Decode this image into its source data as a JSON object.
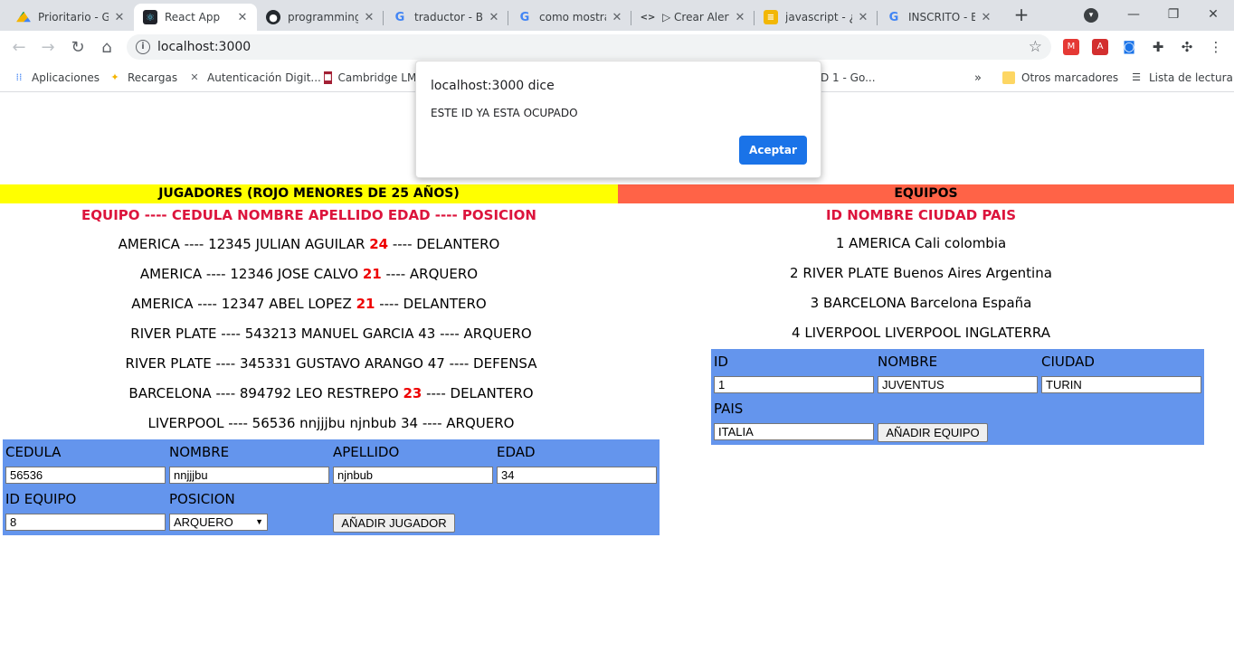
{
  "browser": {
    "tabs": [
      {
        "title": "Prioritario - G",
        "icon": "google-drive-icon"
      },
      {
        "title": "React App",
        "icon": "react-icon"
      },
      {
        "title": "programming",
        "icon": "github-icon"
      },
      {
        "title": "traductor - Bu",
        "icon": "google-icon"
      },
      {
        "title": "como mostrar",
        "icon": "google-icon"
      },
      {
        "title": "▷ Crear Alert",
        "icon": "code-icon"
      },
      {
        "title": "javascript - ¿C",
        "icon": "stackoverflow-icon"
      },
      {
        "title": "INSCRITO - Bu",
        "icon": "google-icon"
      }
    ],
    "url": "localhost:3000",
    "bookmarks": [
      {
        "label": "Aplicaciones",
        "icon": "apps-grid-icon"
      },
      {
        "label": "Recargas",
        "icon": "recargas-icon"
      },
      {
        "label": "Autenticación Digit...",
        "icon": "tools-icon"
      },
      {
        "label": "Cambridge LM",
        "icon": "shield-icon"
      },
      {
        "label": "D 1 - Go...",
        "icon": ""
      }
    ],
    "bookmarks_right": [
      {
        "label": "Otros marcadores",
        "icon": "folder-icon"
      },
      {
        "label": "Lista de lectura",
        "icon": "reading-list-icon"
      }
    ]
  },
  "alert": {
    "title": "localhost:3000 dice",
    "message": "ESTE ID YA ESTA OCUPADO",
    "button": "Aceptar"
  },
  "jugadores": {
    "header": "JUGADORES (ROJO MENORES DE 25 AÑOS)",
    "header_color": "#ffff00",
    "columns": "EQUIPO ---- CEDULA NOMBRE APELLIDO EDAD ---- POSICION",
    "rows": [
      {
        "pre": "AMERICA ---- 12345 JULIAN AGUILAR",
        "age": "24",
        "post": "---- DELANTERO",
        "young": true
      },
      {
        "pre": "AMERICA ---- 12346 JOSE CALVO",
        "age": "21",
        "post": "---- ARQUERO",
        "young": true
      },
      {
        "pre": "AMERICA ---- 12347 ABEL LOPEZ",
        "age": "21",
        "post": "---- DELANTERO",
        "young": true
      },
      {
        "pre": "RIVER PLATE ---- 543213 MANUEL GARCIA",
        "age": "43",
        "post": "---- ARQUERO",
        "young": false
      },
      {
        "pre": "RIVER PLATE ---- 345331 GUSTAVO ARANGO",
        "age": "47",
        "post": "---- DEFENSA",
        "young": false
      },
      {
        "pre": "BARCELONA ---- 894792 LEO RESTREPO",
        "age": "23",
        "post": "---- DELANTERO",
        "young": true
      },
      {
        "pre": "LIVERPOOL ---- 56536 nnjjjbu njnbub",
        "age": "34",
        "post": "---- ARQUERO",
        "young": false
      }
    ],
    "form": {
      "labels": {
        "cedula": "CEDULA",
        "nombre": "NOMBRE",
        "apellido": "APELLIDO",
        "edad": "EDAD",
        "id_equipo": "ID EQUIPO",
        "posicion": "POSICION"
      },
      "values": {
        "cedula": "56536",
        "nombre": "nnjjjbu",
        "apellido": "njnbub",
        "edad": "34",
        "id_equipo": "8",
        "posicion": "ARQUERO"
      },
      "button": "AÑADIR JUGADOR"
    }
  },
  "equipos": {
    "header": "EQUIPOS",
    "header_color": "#ff6347",
    "columns": "ID NOMBRE CIUDAD PAIS",
    "rows": [
      "1 AMERICA Cali colombia",
      "2 RIVER PLATE Buenos Aires Argentina",
      "3 BARCELONA Barcelona España",
      "4 LIVERPOOL LIVERPOOL INGLATERRA"
    ],
    "form": {
      "labels": {
        "id": "ID",
        "nombre": "NOMBRE",
        "ciudad": "CIUDAD",
        "pais": "PAIS"
      },
      "values": {
        "id": "1",
        "nombre": "JUVENTUS",
        "ciudad": "TURIN",
        "pais": "ITALIA"
      },
      "button": "AÑADIR EQUIPO"
    }
  }
}
